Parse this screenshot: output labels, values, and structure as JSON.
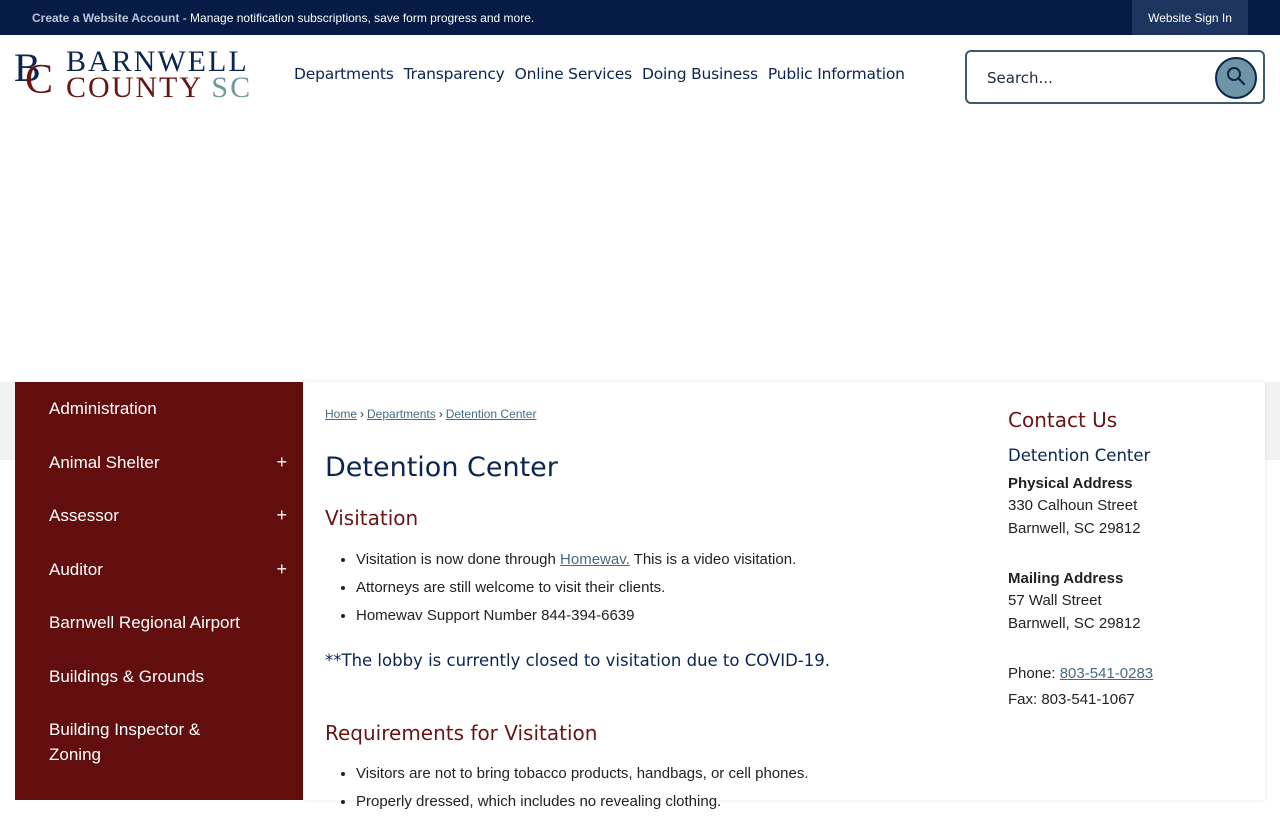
{
  "topbar": {
    "create_account": "Create a Website Account",
    "message": " - Manage notification subscriptions, save form progress and more.",
    "sign_in": "Website Sign In"
  },
  "logo": {
    "initial_b": "B",
    "initial_c": "C",
    "line1": "BARNWELL",
    "line2": "COUNTY",
    "line2_suffix": "SC"
  },
  "nav": {
    "items": [
      "Departments",
      "Transparency",
      "Online Services",
      "Doing Business",
      "Public Information"
    ]
  },
  "search": {
    "placeholder": "Search...",
    "icon": "search-icon"
  },
  "sidebar": {
    "items": [
      {
        "label": "Administration",
        "expand": ""
      },
      {
        "label": "Animal Shelter",
        "expand": "+"
      },
      {
        "label": "Assessor",
        "expand": "+"
      },
      {
        "label": "Auditor",
        "expand": "+"
      },
      {
        "label": "Barnwell Regional Airport",
        "expand": ""
      },
      {
        "label": "Buildings & Grounds",
        "expand": ""
      },
      {
        "label": "Building Inspector & Zoning",
        "expand": ""
      }
    ]
  },
  "breadcrumb": {
    "items": [
      "Home",
      "Departments",
      "Detention Center"
    ],
    "separator": "›"
  },
  "main": {
    "title": "Detention Center",
    "visitation_heading": "Visitation",
    "visitation_items": [
      {
        "before": "Visitation is now done through ",
        "link": "Homewav.",
        "after": " This is a video visitation."
      },
      {
        "before": "Attorneys are still welcome to visit their clients.",
        "link": "",
        "after": ""
      },
      {
        "before": "Homewav Support Number 844-394-6639",
        "link": "",
        "after": ""
      }
    ],
    "notice": "**The lobby is currently closed to visitation due to COVID-19.",
    "requirements_heading": "Requirements for Visitation",
    "requirements_items": [
      "Visitors are not to bring tobacco products, handbags, or cell phones.",
      "Properly dressed, which includes no revealing clothing."
    ]
  },
  "contact": {
    "title": "Contact Us",
    "department": "Detention Center",
    "physical_label": "Physical Address",
    "physical_line1": "330 Calhoun Street",
    "physical_line2": "Barnwell, SC 29812",
    "mailing_label": "Mailing Address",
    "mailing_line1": "57 Wall Street",
    "mailing_line2": "Barnwell, SC 29812",
    "phone_label": "Phone: ",
    "phone": "803-541-0283",
    "fax": "Fax: 803-541-1067"
  },
  "colors": {
    "navy": "#0c2450",
    "maroon": "#620e0e",
    "teal": "#6d95a5"
  }
}
